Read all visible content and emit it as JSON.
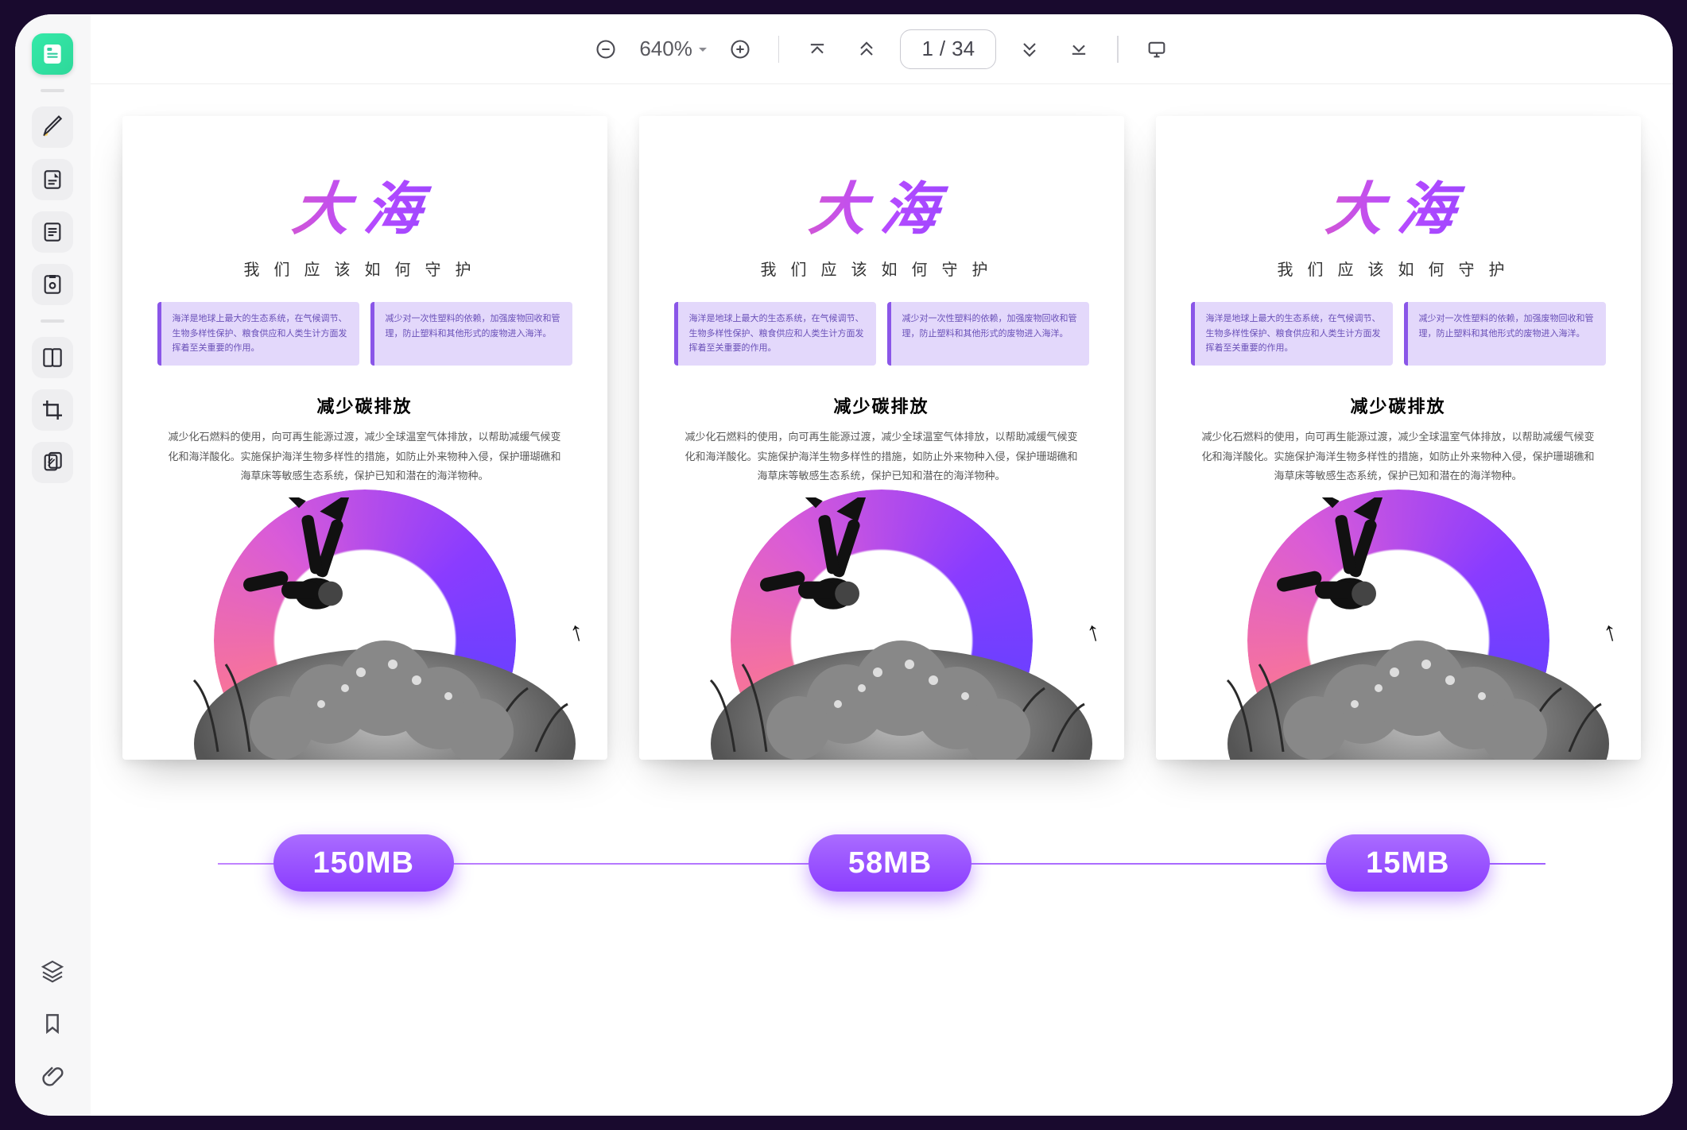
{
  "toolbar": {
    "zoom_value": "640%",
    "page_current": "1",
    "page_sep": "/",
    "page_total": "34"
  },
  "document": {
    "title": "大海",
    "subtitle": "我们应该如何守护",
    "info_left": "海洋是地球上最大的生态系统，在气候调节、生物多样性保护、粮食供应和人类生计方面发挥着至关重要的作用。",
    "info_right": "减少对一次性塑料的依赖，加强废物回收和管理，防止塑料和其他形式的废物进入海洋。",
    "section_title": "减少碳排放",
    "section_body": "减少化石燃料的使用，向可再生能源过渡，减少全球温室气体排放，以帮助减缓气候变化和海洋酸化。实施保护海洋生物多样性的措施，如防止外来物种入侵，保护珊瑚礁和海草床等敏感生态系统，保护已知和潜在的海洋物种。"
  },
  "file_sizes": [
    "150MB",
    "58MB",
    "15MB"
  ],
  "icons": {
    "brand": "book-icon",
    "marker": "highlighter-icon",
    "typewriter": "typewriter-icon",
    "outline": "outline-icon",
    "fill": "fill-form-icon",
    "compare": "compare-icon",
    "crop": "crop-icon",
    "duplicate": "duplicate-icon",
    "layers": "layers-icon",
    "bookmark": "bookmark-icon",
    "attach": "paperclip-icon"
  }
}
